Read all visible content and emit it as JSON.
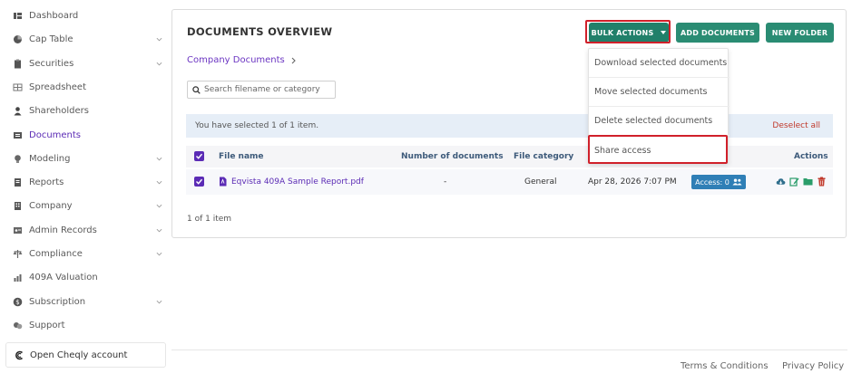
{
  "sidebar": {
    "items": [
      {
        "label": "Dashboard",
        "icon": "dashboard-icon"
      },
      {
        "label": "Cap Table",
        "icon": "pie-chart-icon"
      },
      {
        "label": "Securities",
        "icon": "clipboard-icon"
      },
      {
        "label": "Spreadsheet",
        "icon": "spreadsheet-icon"
      },
      {
        "label": "Shareholders",
        "icon": "user-icon"
      },
      {
        "label": "Documents",
        "icon": "folder-icon"
      },
      {
        "label": "Modeling",
        "icon": "lightbulb-icon"
      },
      {
        "label": "Reports",
        "icon": "report-icon"
      },
      {
        "label": "Company",
        "icon": "building-icon"
      },
      {
        "label": "Admin Records",
        "icon": "records-icon"
      },
      {
        "label": "Compliance",
        "icon": "scale-icon"
      },
      {
        "label": "409A Valuation",
        "icon": "valuation-icon"
      },
      {
        "label": "Subscription",
        "icon": "dollar-icon"
      },
      {
        "label": "Support",
        "icon": "support-icon"
      }
    ],
    "active": "Documents",
    "cheqly_label": "Open Cheqly account"
  },
  "main": {
    "title": "DOCUMENTS OVERVIEW",
    "breadcrumb": "Company Documents",
    "buttons": {
      "bulk": "BULK ACTIONS",
      "add": "ADD DOCUMENTS",
      "folder": "NEW FOLDER"
    },
    "search_placeholder": "Search filename or category",
    "selection_text": "You have selected 1 of 1 item.",
    "deselect_label": "Deselect all",
    "columns": {
      "file_name": "File name",
      "num_docs": "Number of documents",
      "category": "File category",
      "actions": "Actions"
    },
    "rows": [
      {
        "file_name": "Eqvista 409A Sample Report.pdf",
        "num_docs": "-",
        "category": "General",
        "date": "Apr 28, 2026 7:07 PM",
        "access": "Access: 0"
      }
    ],
    "pagination": "1 of 1 item"
  },
  "dropdown": {
    "items": [
      "Download selected documents",
      "Move selected documents",
      "Delete selected documents",
      "Share access"
    ]
  },
  "footer": {
    "terms": "Terms & Conditions",
    "privacy": "Privacy Policy"
  },
  "colors": {
    "accent_purple": "#5b2bb5",
    "button_green": "#21806a",
    "highlight_red": "#d0202a",
    "badge_blue": "#2f7fb6"
  }
}
